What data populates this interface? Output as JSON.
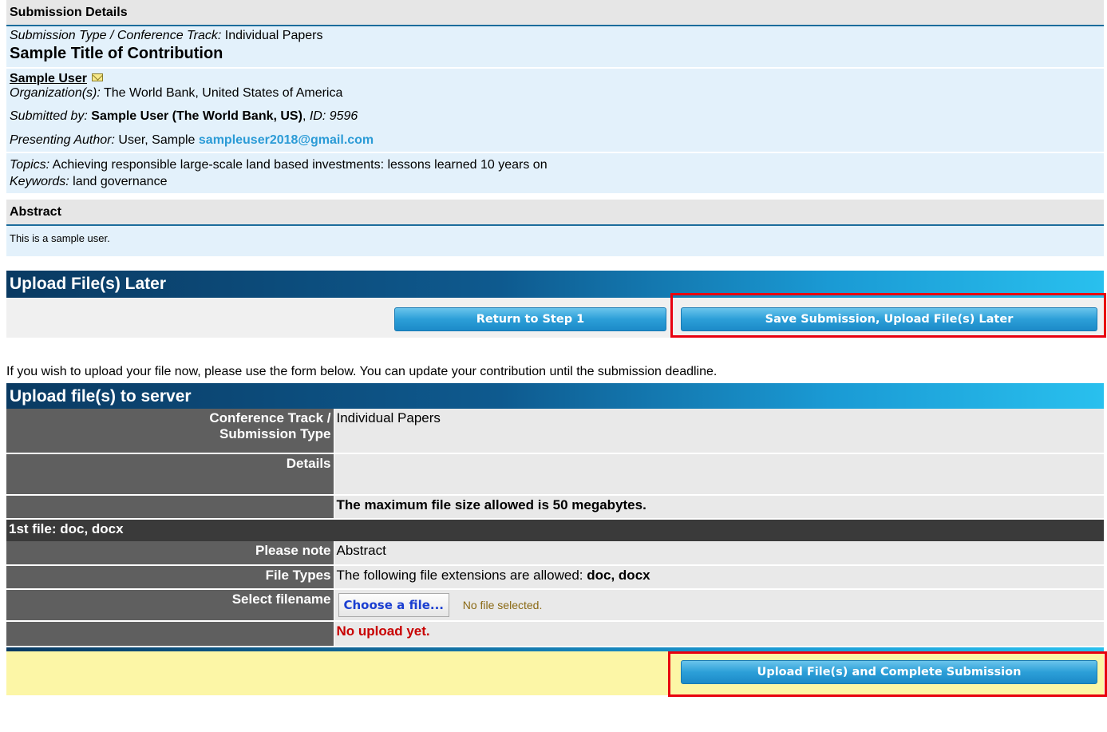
{
  "details": {
    "header": "Submission Details",
    "type_label": "Submission Type / Conference Track:",
    "type_value": "Individual Papers",
    "title": "Sample Title of Contribution",
    "author_name": "Sample User",
    "org_label": "Organization(s):",
    "org_value": "The World Bank, United States of America",
    "submitted_label": "Submitted by:",
    "submitted_value": "Sample User (The World Bank, US)",
    "id_label": "ID: 9596",
    "presenting_label": "Presenting Author:",
    "presenting_value": "User, Sample",
    "presenting_email": "sampleuser2018@gmail.com",
    "topics_label": "Topics:",
    "topics_value": "Achieving responsible large-scale land based investments: lessons learned 10 years on",
    "keywords_label": "Keywords:",
    "keywords_value": "land governance"
  },
  "abstract": {
    "header": "Abstract",
    "body": "This is a sample user."
  },
  "later": {
    "header": "Upload File(s) Later",
    "return_btn": "Return to Step 1",
    "save_btn": "Save Submission, Upload File(s) Later"
  },
  "info_text": "If you wish to upload your file now, please use the form below. You can update your contribution until the submission deadline.",
  "upload": {
    "header": "Upload file(s) to server",
    "track_label_1": "Conference Track /",
    "track_label_2": "Submission Type",
    "track_value": "Individual Papers",
    "details_label": "Details",
    "details_value": "",
    "max_size": "The maximum file size allowed is 50 megabytes.",
    "file_header": "1st file: doc, docx",
    "note_label": "Please note",
    "note_value": "Abstract",
    "types_label": "File Types",
    "types_value": "The following file extensions are allowed:",
    "types_ext": "doc, docx",
    "select_label": "Select filename",
    "choose_btn": "Choose a file...",
    "no_file": "No file selected.",
    "no_upload": "No upload yet.",
    "complete_btn": "Upload File(s) and Complete Submission"
  },
  "colors": {
    "highlight_frame": "#e8000f",
    "link_blue": "#2b9bd6",
    "warning_red": "#c80000"
  }
}
